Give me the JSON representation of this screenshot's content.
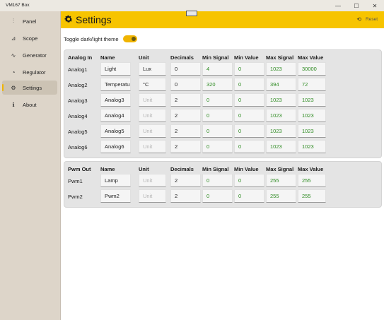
{
  "window": {
    "title": "VM167 Box",
    "minimize": "—",
    "maximize": "☐",
    "close": "✕"
  },
  "sidebar": {
    "items": [
      {
        "label": "Panel",
        "icon": "sliders-icon",
        "glyph": "⫶"
      },
      {
        "label": "Scope",
        "icon": "chart-area-icon",
        "glyph": "⊿"
      },
      {
        "label": "Generator",
        "icon": "wave-icon",
        "glyph": "∿"
      },
      {
        "label": "Regulator",
        "icon": "gauge-icon",
        "glyph": "◔"
      },
      {
        "label": "Settings",
        "icon": "gear-icon",
        "glyph": "⚙",
        "active": true
      },
      {
        "label": "About",
        "icon": "info-icon",
        "glyph": "ℹ"
      }
    ]
  },
  "header": {
    "title": "Settings",
    "reset_label": "Reset",
    "bg": "#f7c400"
  },
  "toggle": {
    "label": "Toggle dark/light theme",
    "on": true
  },
  "analog": {
    "headers": [
      "Analog In",
      "Name",
      "Unit",
      "Decimals",
      "Min Signal",
      "Min Value",
      "Max Signal",
      "Max Value"
    ],
    "unit_placeholder": "Unit",
    "rows": [
      {
        "label": "Analog1",
        "name": "Light",
        "unit": "Lux",
        "decimals": "0",
        "min_signal": "4",
        "min_value": "0",
        "max_signal": "1023",
        "max_value": "30000"
      },
      {
        "label": "Analog2",
        "name": "Temperatur",
        "unit": "°C",
        "decimals": "0",
        "min_signal": "320",
        "min_value": "0",
        "max_signal": "394",
        "max_value": "72"
      },
      {
        "label": "Analog3",
        "name": "Analog3",
        "unit": "",
        "decimals": "2",
        "min_signal": "0",
        "min_value": "0",
        "max_signal": "1023",
        "max_value": "1023"
      },
      {
        "label": "Analog4",
        "name": "Analog4",
        "unit": "",
        "decimals": "2",
        "min_signal": "0",
        "min_value": "0",
        "max_signal": "1023",
        "max_value": "1023"
      },
      {
        "label": "Analog5",
        "name": "Analog5",
        "unit": "",
        "decimals": "2",
        "min_signal": "0",
        "min_value": "0",
        "max_signal": "1023",
        "max_value": "1023"
      },
      {
        "label": "Analog6",
        "name": "Analog6",
        "unit": "",
        "decimals": "2",
        "min_signal": "0",
        "min_value": "0",
        "max_signal": "1023",
        "max_value": "1023"
      }
    ]
  },
  "pwm": {
    "headers": [
      "Pwm Out",
      "Name",
      "Unit",
      "Decimals",
      "Min Signal",
      "Min Value",
      "Max Signal",
      "Max Value"
    ],
    "unit_placeholder": "Unit",
    "rows": [
      {
        "label": "Pwm1",
        "name": "Lamp",
        "unit": "",
        "decimals": "2",
        "min_signal": "0",
        "min_value": "0",
        "max_signal": "255",
        "max_value": "255"
      },
      {
        "label": "Pwm2",
        "name": "Pwm2",
        "unit": "",
        "decimals": "2",
        "min_signal": "0",
        "min_value": "0",
        "max_signal": "255",
        "max_value": "255"
      }
    ]
  },
  "colors": {
    "accent": "#f7c400",
    "value_green": "#2e8b22",
    "sidebar_bg": "#ddd5c9"
  }
}
